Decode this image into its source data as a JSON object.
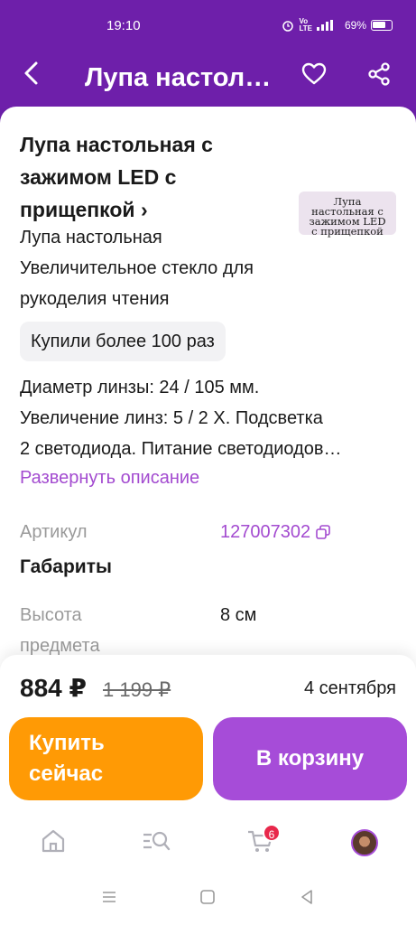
{
  "status_bar": {
    "time": "19:10",
    "battery": "69%",
    "icons": [
      "alarm-icon",
      "volte-icon",
      "signal-4g-icon",
      "signal-icon",
      "battery-icon"
    ]
  },
  "header": {
    "title": "Лупа настольная с зажимом LED с прищепкой",
    "icons": [
      "back-arrow-icon",
      "heart-icon",
      "share-icon"
    ]
  },
  "product": {
    "title": "Лупа настольная с зажимом LED с прищепкой ›",
    "thumbnail_text": [
      "Лупа",
      "настольная с",
      "зажимом LED",
      "с прищепкой"
    ],
    "subtitle": "Лупа настольная Увеличительное стекло для рукоделия чтения",
    "badge": "Купили более 100 раз",
    "description_lines": [
      "Диаметр линзы: 24 / 105 мм.",
      "Увеличение линз: 5 / 2 Х. Подсветка",
      "2 светодиода. Питание светодиодов…"
    ],
    "expand_link": "Развернуть описание"
  },
  "specs": {
    "article_label": "Артикул",
    "article_value": "127007302",
    "dimensions_heading": "Габариты",
    "height_label": "Высота предмета",
    "height_value": "8 см"
  },
  "purchase": {
    "price": "884 ₽",
    "old_price": "1 199 ₽",
    "delivery": "4 сентября",
    "buy_now_label": "Купить сейчас",
    "add_to_cart_label": "В корзину"
  },
  "tab_bar": {
    "items": [
      "home-icon",
      "catalog-search-icon",
      "cart-icon",
      "profile-avatar"
    ],
    "cart_count": "6"
  },
  "colors": {
    "brand": "#6e1faa",
    "accent": "#a64cd8",
    "buy_button": "#ff9a05",
    "badge_red": "#e8284b"
  }
}
